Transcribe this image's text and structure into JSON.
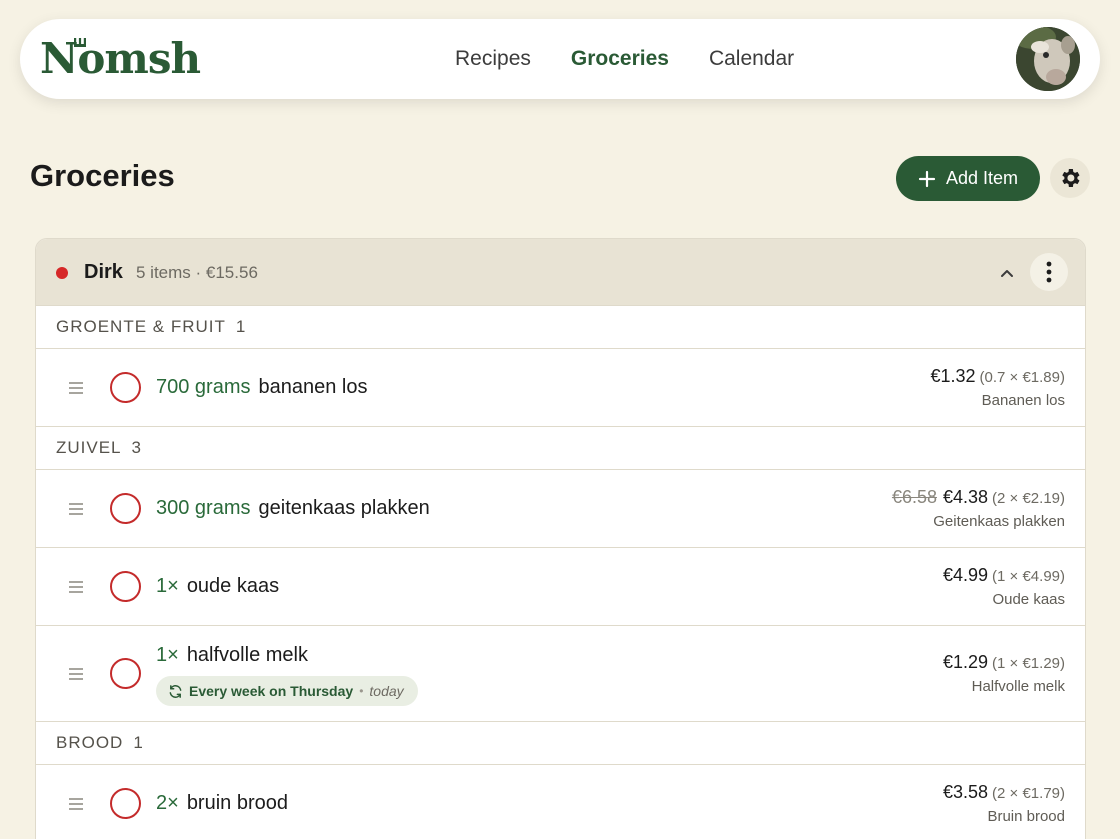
{
  "app": {
    "brand": "Nomsh",
    "nav": [
      {
        "label": "Recipes",
        "active": false
      },
      {
        "label": "Groceries",
        "active": true
      },
      {
        "label": "Calendar",
        "active": false
      }
    ]
  },
  "page": {
    "title": "Groceries",
    "add_button_label": "Add Item"
  },
  "store": {
    "name": "Dirk",
    "meta": "5 items · €15.56",
    "dot_color": "#d62828"
  },
  "categories": [
    {
      "name": "Groente & Fruit",
      "count": "1",
      "items": [
        {
          "qty": "700 grams",
          "name": "bananen los",
          "old_price": "",
          "price": "€1.32",
          "calc": "(0.7 × €1.89)",
          "product": "Bananen los"
        }
      ]
    },
    {
      "name": "Zuivel",
      "count": "3",
      "items": [
        {
          "qty": "300 grams",
          "name": "geitenkaas plakken",
          "old_price": "€6.58",
          "price": "€4.38",
          "calc": "(2 × €2.19)",
          "product": "Geitenkaas plakken"
        },
        {
          "qty": "1×",
          "name": "oude kaas",
          "old_price": "",
          "price": "€4.99",
          "calc": "(1 × €4.99)",
          "product": "Oude kaas"
        },
        {
          "qty": "1×",
          "name": "halfvolle melk",
          "old_price": "",
          "price": "€1.29",
          "calc": "(1 × €1.29)",
          "product": "Halfvolle melk",
          "recurrence": {
            "text": "Every week on Thursday",
            "separator": "•",
            "when": "today"
          }
        }
      ]
    },
    {
      "name": "Brood",
      "count": "1",
      "items": [
        {
          "qty": "2×",
          "name": "bruin brood",
          "old_price": "",
          "price": "€3.58",
          "calc": "(2 × €1.79)",
          "product": "Bruin brood"
        }
      ]
    }
  ],
  "colors": {
    "brand": "#2a5a35",
    "background": "#f6f2e4",
    "unchecked": "#c42b2b"
  }
}
